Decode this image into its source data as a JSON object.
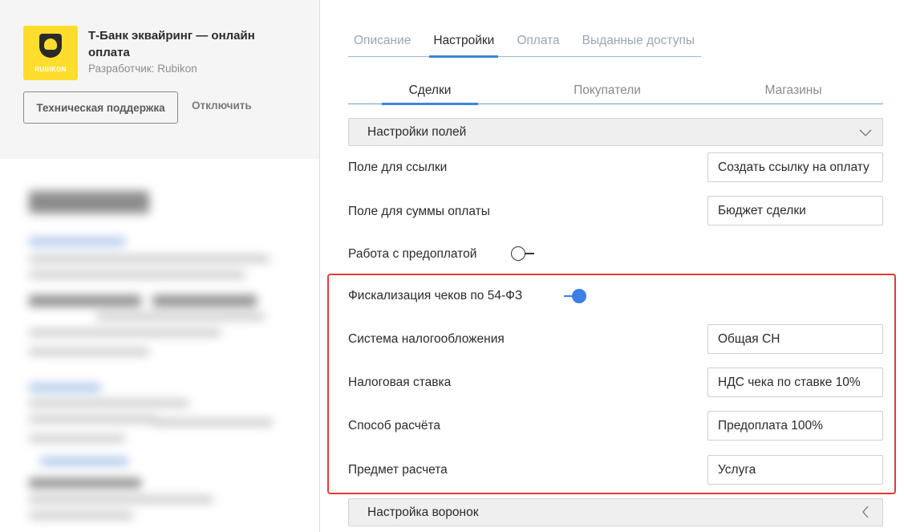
{
  "app": {
    "title": "Т-Банк эквайринг — онлайн оплата",
    "developer": "Разработчик: Rubikon",
    "logo_text": "RUBIKON",
    "support_button": "Техническая поддержка",
    "disable_button": "Отключить"
  },
  "tabs": [
    {
      "label": "Описание",
      "active": false
    },
    {
      "label": "Настройки",
      "active": true
    },
    {
      "label": "Оплата",
      "active": false
    },
    {
      "label": "Выданные доступы",
      "active": false
    }
  ],
  "subtabs": [
    {
      "label": "Сделки",
      "active": true
    },
    {
      "label": "Покупатели",
      "active": false
    },
    {
      "label": "Магазины",
      "active": false
    }
  ],
  "sections": {
    "fields_settings": "Настройки полей",
    "funnels_settings": "Настройка воронок"
  },
  "rows": {
    "link_field": {
      "label": "Поле для ссылки",
      "value": "Создать ссылку на оплату"
    },
    "amount_field": {
      "label": "Поле для суммы оплаты",
      "value": "Бюджет сделки"
    },
    "prepayment": {
      "label": "Работа с предоплатой",
      "enabled": false
    },
    "fiscalization": {
      "label": "Фискализация чеков по 54-ФЗ",
      "enabled": true
    },
    "tax_system": {
      "label": "Система налогообложения",
      "value": "Общая СН"
    },
    "tax_rate": {
      "label": "Налоговая ставка",
      "value": "НДС чека по ставке 10%"
    },
    "payment_method": {
      "label": "Способ расчёта",
      "value": "Предоплата 100%"
    },
    "payment_subject": {
      "label": "Предмет расчета",
      "value": "Услуга"
    }
  },
  "colors": {
    "accent": "#3e85d6",
    "toggle_on": "#3c7fe6",
    "highlight": "#e53935",
    "logo_bg": "#ffdd2d"
  }
}
